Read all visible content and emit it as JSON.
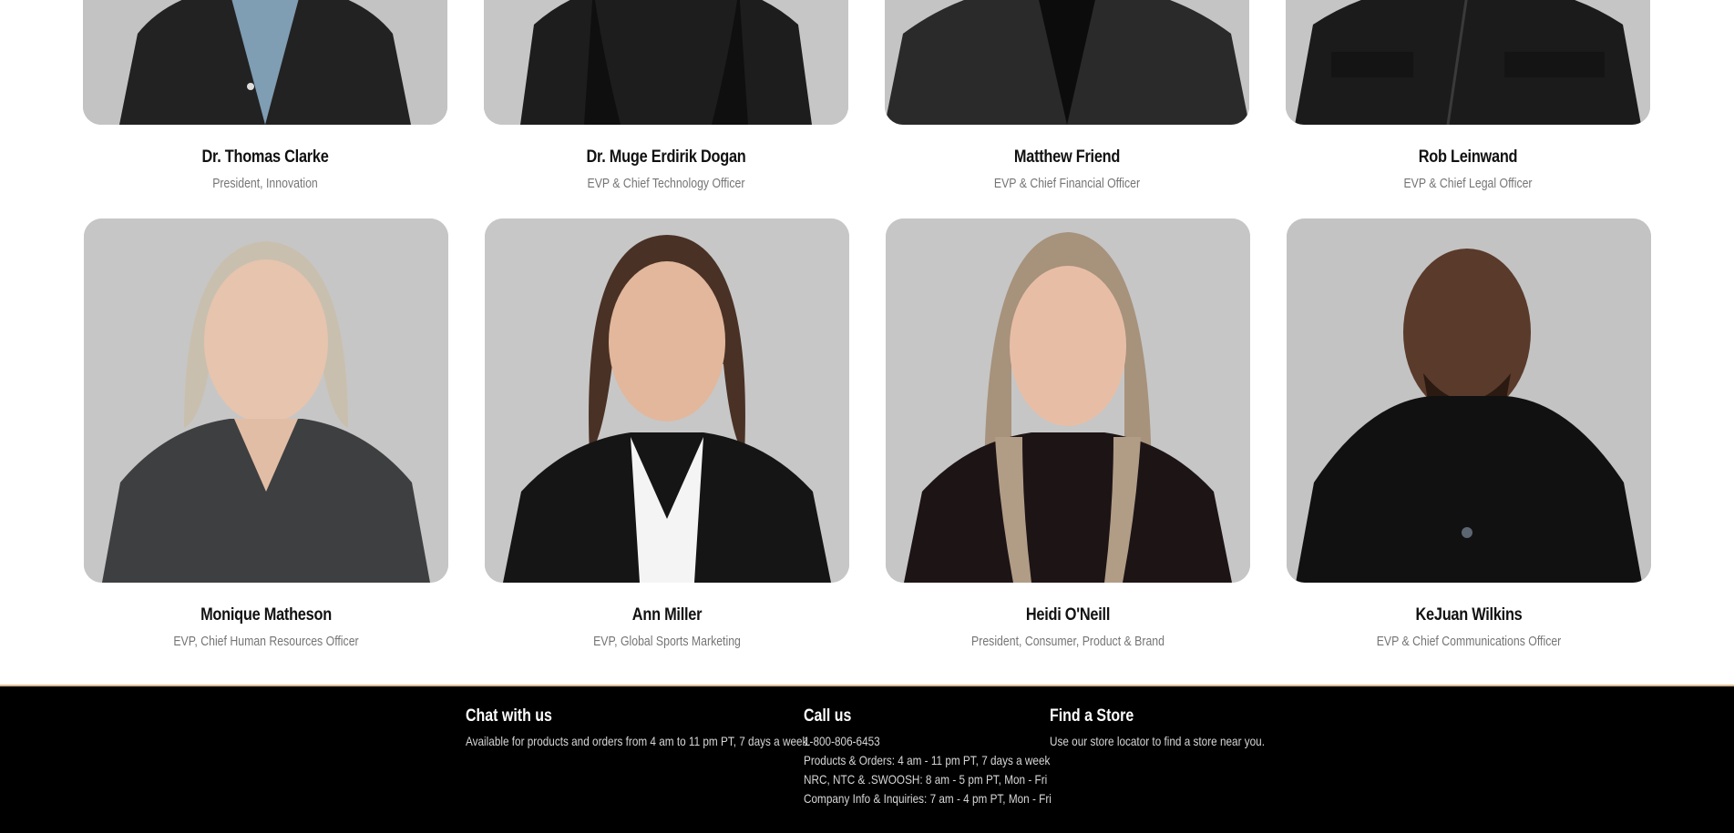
{
  "people": [
    {
      "name": "Dr. Thomas Clarke",
      "title": "President, Innovation",
      "photo": "portrait-photo"
    },
    {
      "name": "Dr. Muge Erdirik Dogan",
      "title": "EVP & Chief Technology Officer",
      "photo": "portrait-photo"
    },
    {
      "name": "Matthew Friend",
      "title": "EVP & Chief Financial Officer",
      "photo": "portrait-photo"
    },
    {
      "name": "Rob Leinwand",
      "title": "EVP & Chief Legal Officer",
      "photo": "portrait-photo"
    },
    {
      "name": "Monique Matheson",
      "title": "EVP, Chief Human Resources Officer",
      "photo": "portrait-photo"
    },
    {
      "name": "Ann Miller",
      "title": "EVP, Global Sports Marketing",
      "photo": "portrait-photo"
    },
    {
      "name": "Heidi O'Neill",
      "title": "President, Consumer, Product & Brand",
      "photo": "portrait-photo"
    },
    {
      "name": "KeJuan Wilkins",
      "title": "EVP & Chief Communications Officer",
      "photo": "portrait-photo"
    }
  ],
  "footer": {
    "chat": {
      "heading": "Chat with us",
      "text": "Available for products and orders from 4 am to 11 pm PT, 7 days a week."
    },
    "call": {
      "heading": "Call us",
      "phone": "1-800-806-6453",
      "lines": [
        "Products & Orders: 4 am - 11 pm PT, 7 days a week",
        "NRC, NTC & .SWOOSH: 8 am - 5 pm PT, Mon - Fri",
        "Company Info & Inquiries: 7 am - 4 pm PT, Mon - Fri"
      ]
    },
    "store": {
      "heading": "Find a Store",
      "text": "Use our store locator to find a store near you."
    }
  },
  "colors": {
    "footer_bg": "#000000",
    "footer_border": "#d9b88f",
    "role_text": "#757575",
    "photo_bg": "#c4c4c4"
  }
}
